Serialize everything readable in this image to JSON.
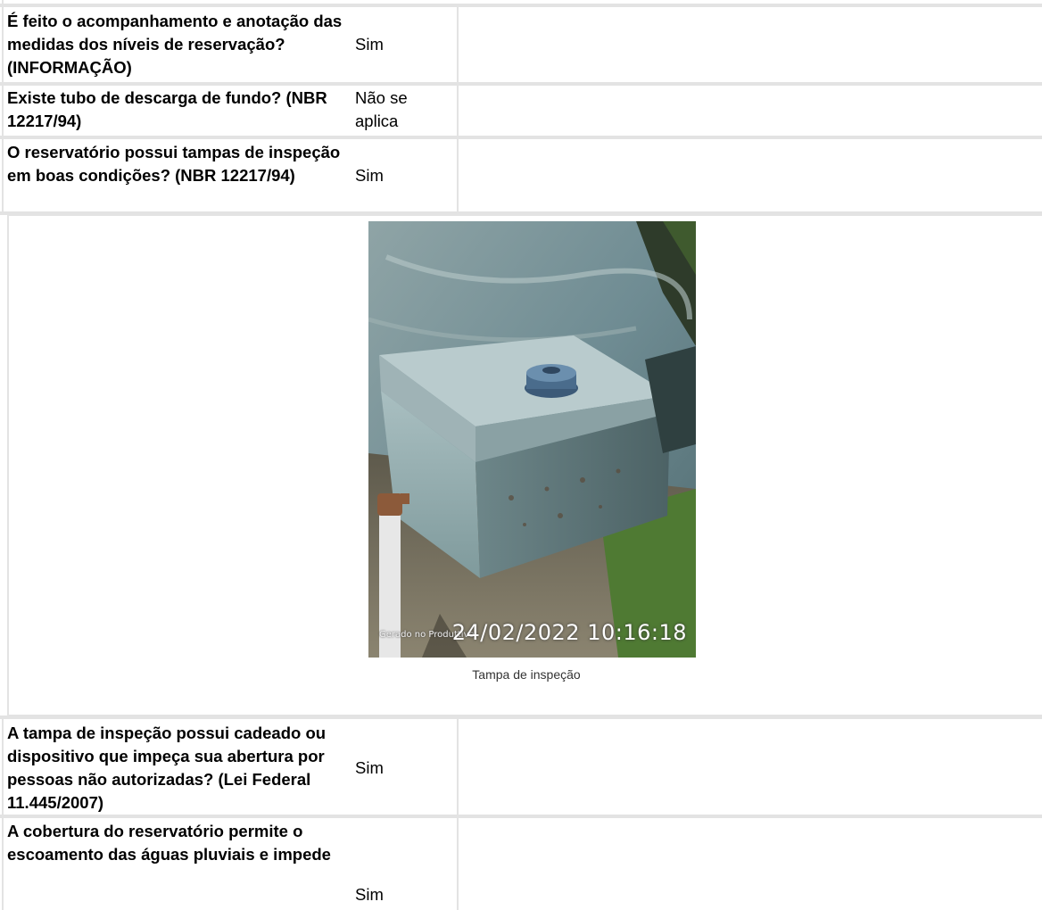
{
  "rows": [
    {
      "question": "É feito o acompanhamento e anotação das medidas dos níveis de reservação? (INFORMAÇÃO)",
      "answer": "Sim"
    },
    {
      "question": "Existe tubo de descarga de fundo? (NBR 12217/94)",
      "answer": "Não se aplica"
    },
    {
      "question": "O reservatório possui tampas de inspeção em boas condições? (NBR 12217/94)",
      "answer": "Sim"
    },
    {
      "question": "A tampa de inspeção possui cadeado ou dispositivo que impeça sua abertura por pessoas não autorizadas? (Lei Federal 11.445/2007)",
      "answer": "Sim"
    },
    {
      "question": "A cobertura do reservatório permite o escoamento das águas pluviais e impede",
      "answer": "Sim"
    }
  ],
  "photo": {
    "caption": "Tampa de inspeção",
    "source_text": "Gerado no Produttivo",
    "timestamp": "24/02/2022 10:16:18"
  }
}
